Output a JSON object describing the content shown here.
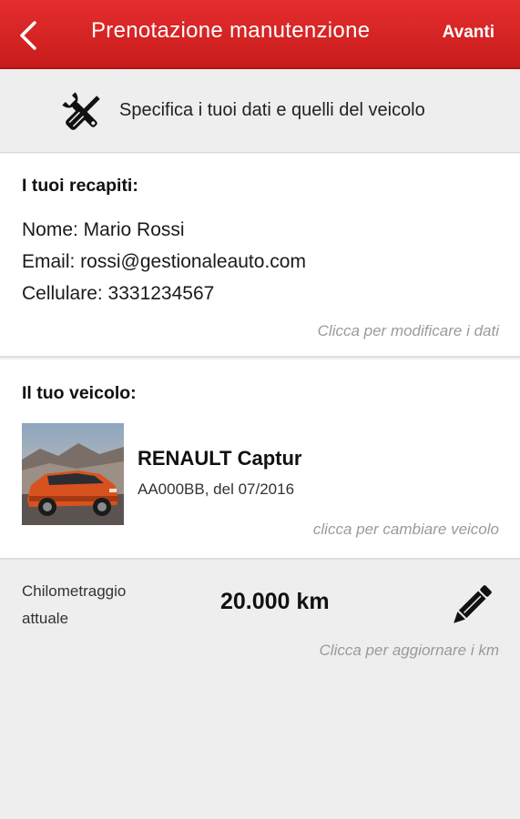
{
  "topbar": {
    "title": "Prenotazione manutenzione",
    "next_label": "Avanti",
    "back_icon": "chevron-left-icon",
    "color": "#d92424"
  },
  "header": {
    "icon": "wrench-screwdriver-icon",
    "text": "Specifica i tuoi dati e quelli del veicolo"
  },
  "contacts": {
    "title": "I tuoi recapiti:",
    "name": "Nome: Mario Rossi",
    "email": "Email: rossi@gestionaleauto.com",
    "phone": "Cellulare: 3331234567",
    "hint": "Clicca per modificare i dati"
  },
  "vehicle": {
    "title": "Il tuo veicolo:",
    "name": "RENAULT Captur",
    "plate": "AA000BB, del 07/2016",
    "hint": "clicca per cambiare veicolo",
    "image": "car-photo"
  },
  "mileage": {
    "label": "Chilometraggio attuale",
    "value": "20.000 km",
    "hint": "Clicca per aggiornare i km",
    "icon": "pencil-icon"
  }
}
